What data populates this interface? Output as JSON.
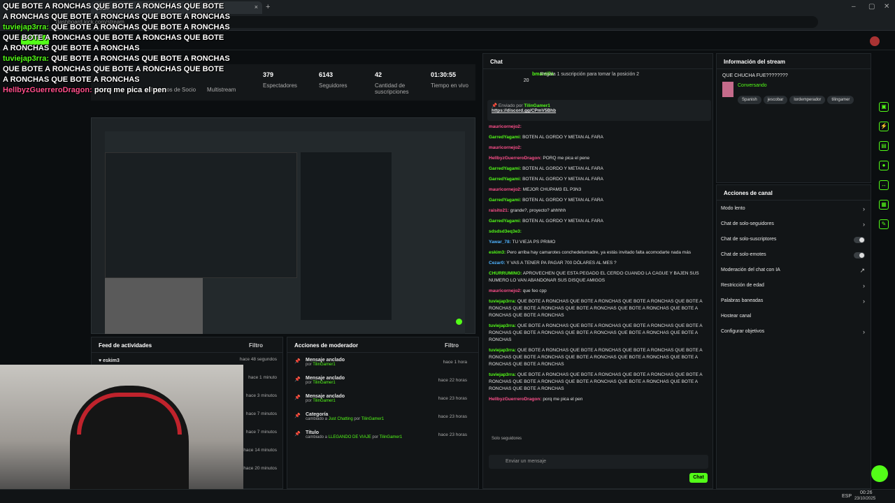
{
  "browser": {
    "tab_title": "Kick",
    "url": "dashboard.kick.com/stream",
    "close_icon": "close-icon",
    "new_tab": "+"
  },
  "stats": [
    {
      "value": "379",
      "label": "Espectadores"
    },
    {
      "value": "6143",
      "label": "Seguidores"
    },
    {
      "value": "42",
      "label": "Cantidad de suscripciones"
    },
    {
      "value": "01:30:55",
      "label": "Tiempo en vivo"
    }
  ],
  "stats_left": [
    "Sesión",
    "Ingresos de Socio",
    "Multistream"
  ],
  "overlay": [
    {
      "user": "",
      "text": "QUE BOTE A RONCHAS QUE BOTE A RONCHAS QUE BOTE A RONCHAS QUE BOTE A RONCHAS QUE BOTE A RONCHAS"
    },
    {
      "user": "tuviejap3rra:",
      "text": "QUE BOTE A RONCHAS QUE BOTE A RONCHAS QUE BOTE A RONCHAS QUE BOTE A RONCHAS QUE BOTE A RONCHAS QUE BOTE A RONCHAS"
    },
    {
      "user": "tuviejap3rra:",
      "text": "QUE BOTE A RONCHAS QUE BOTE A RONCHAS QUE BOTE A RONCHAS QUE BOTE A RONCHAS QUE BOTE A RONCHAS QUE BOTE A RONCHAS"
    },
    {
      "user": "HellbyzGuerreroDragon:",
      "text": "porq me pica el pen"
    }
  ],
  "chat": {
    "title": "Chat",
    "gift_user": "bmantilla",
    "gift_count": "20",
    "gift_text": "Regala 1 suscripción para tomar la posición 2",
    "pinned_by": "Enviado por",
    "pinned_user": "TilinGamer1",
    "pinned_link": "https://discord.gg/CPmV5Bhb",
    "messages": [
      {
        "user": "mauricornejo2:",
        "text": "",
        "color": "#ff4f8b"
      },
      {
        "user": "GarredYagami:",
        "text": "BOTEN AL GORDO Y METAN AL FARA",
        "color": "#53fc18"
      },
      {
        "user": "mauricornejo2:",
        "text": "",
        "color": "#ff4f8b"
      },
      {
        "user": "HellbyzGuerreroDragon:",
        "text": "PORQ me pica el pene",
        "color": "#ff4f8b"
      },
      {
        "user": "GarredYagami:",
        "text": "BOTEN AL GORDO Y METAN AL FARA",
        "color": "#53fc18"
      },
      {
        "user": "GarredYagami:",
        "text": "BOTEN AL GORDO Y METAN AL FARA",
        "color": "#53fc18"
      },
      {
        "user": "mauricornejo2:",
        "text": "MEJOR CHUPAM3 EL P3N3",
        "color": "#ff4f8b"
      },
      {
        "user": "GarredYagami:",
        "text": "BOTEN AL GORDO Y METAN AL FARA",
        "color": "#53fc18"
      },
      {
        "user": "raisito21:",
        "text": "grande?, proyecto? ahhhhh",
        "color": "#ff4f8b"
      },
      {
        "user": "GarredYagami:",
        "text": "BOTEN AL GORDO Y METAN AL FARA",
        "color": "#53fc18"
      },
      {
        "user": "sdsdsd3eq3e3:",
        "text": "",
        "color": "#53fc18"
      },
      {
        "user": "Yawar_78:",
        "text": "TU VIEJA PS PRIMO",
        "color": "#4fb3ff"
      },
      {
        "user": "eskim3:",
        "text": "Pero arriba hay camarotes conchedetumadre, ya estás invitado falta acomodarte nada más",
        "color": "#53fc18"
      },
      {
        "user": "Cezar0:",
        "text": "Y VAS A TENER PA PAGAR 700 DÓLARES AL MES ?",
        "color": "#4fb3ff"
      },
      {
        "user": "CHURRUMINO:",
        "text": "APROVECHEN QUE ESTA PEGADO EL CERDO CUANDO LA CAGUE Y BAJEN SUS NUMERO LO VAN ABANDONAR SUS DISQUE AMIGOS",
        "color": "#53fc18"
      },
      {
        "user": "mauricornejo2:",
        "text": "que feo cpp",
        "color": "#ff4f8b"
      },
      {
        "user": "tuviejap3rra:",
        "text": "QUE BOTE A RONCHAS QUE BOTE A RONCHAS QUE BOTE A RONCHAS QUE BOTE A RONCHAS QUE BOTE A RONCHAS QUE BOTE A RONCHAS QUE BOTE A RONCHAS QUE BOTE A RONCHAS QUE BOTE A RONCHAS",
        "color": "#53fc18"
      },
      {
        "user": "tuviejap3rra:",
        "text": "QUE BOTE A RONCHAS QUE BOTE A RONCHAS QUE BOTE A RONCHAS QUE BOTE A RONCHAS QUE BOTE A RONCHAS QUE BOTE A RONCHAS QUE BOTE A RONCHAS QUE BOTE A RONCHAS",
        "color": "#53fc18"
      },
      {
        "user": "tuviejap3rra:",
        "text": "QUE BOTE A RONCHAS QUE BOTE A RONCHAS QUE BOTE A RONCHAS QUE BOTE A RONCHAS QUE BOTE A RONCHAS QUE BOTE A RONCHAS QUE BOTE A RONCHAS QUE BOTE A RONCHAS QUE BOTE A RONCHAS",
        "color": "#53fc18"
      },
      {
        "user": "tuviejap3rra:",
        "text": "QUE BOTE A RONCHAS QUE BOTE A RONCHAS QUE BOTE A RONCHAS QUE BOTE A RONCHAS QUE BOTE A RONCHAS QUE BOTE A RONCHAS QUE BOTE A RONCHAS QUE BOTE A RONCHAS QUE BOTE A RONCHAS",
        "color": "#53fc18"
      },
      {
        "user": "HellbyzGuerreroDragon:",
        "text": "porq me pica el pen",
        "color": "#ff4f8b"
      }
    ],
    "followers_only": "Solo seguidores",
    "input_placeholder": "Enviar un mensaje",
    "send_label": "Chat"
  },
  "stream_info": {
    "title": "Información del stream",
    "stream_title": "QUE CHUCHA FUE????????",
    "category": "Conversando",
    "tags": [
      "Spanish",
      "jescobar",
      "lordemperador",
      "tilingamer"
    ]
  },
  "channel_actions": {
    "title": "Acciones de canal",
    "items": [
      {
        "label": "Modo lento",
        "kind": "chevron"
      },
      {
        "label": "Chat de solo-seguidores",
        "kind": "chevron"
      },
      {
        "label": "Chat de solo-suscriptores",
        "kind": "toggle"
      },
      {
        "label": "Chat de solo-emotes",
        "kind": "toggle"
      },
      {
        "label": "Moderación del chat con IA",
        "kind": "external"
      },
      {
        "label": "Restricción de edad",
        "kind": "chevron"
      },
      {
        "label": "Palabras baneadas",
        "kind": "chevron"
      },
      {
        "label": "Hostear canal",
        "kind": "none"
      },
      {
        "label": "Configurar objetivos",
        "kind": "chevron"
      }
    ]
  },
  "activity_feed": {
    "title": "Feed de actividades",
    "filter": "Filtro",
    "first_user": "eskim3",
    "first_time": "hace 48 segundos",
    "times": [
      "hace 1 minuto",
      "hace 3 minutos",
      "hace 7 minutos",
      "hace 7 minutos",
      "hace 14 minutos",
      "hace 20 minutos"
    ]
  },
  "mod_actions": {
    "title": "Acciones de moderador",
    "filter": "Filtro",
    "items": [
      {
        "title": "Mensaje anclado",
        "sub": "por",
        "user": "TilinGamer1",
        "time": "hace 1 hora"
      },
      {
        "title": "Mensaje anclado",
        "sub": "por",
        "user": "TilinGamer1",
        "time": "hace 22 horas"
      },
      {
        "title": "Mensaje anclado",
        "sub": "por",
        "user": "TilinGamer1",
        "time": "hace 23 horas"
      },
      {
        "title": "Categoría",
        "sub": "cambiado a",
        "value": "Just Chatting",
        "user": "TilinGamer1",
        "time": "hace 23 horas"
      },
      {
        "title": "Título",
        "sub": "cambiado a",
        "value": "LLEGANDO DE VIAJE",
        "user": "TilinGamer1",
        "time": "hace 23 horas"
      }
    ]
  },
  "taskbar": {
    "lang": "ESP",
    "time": "00:26",
    "date": "23/10/2025"
  }
}
